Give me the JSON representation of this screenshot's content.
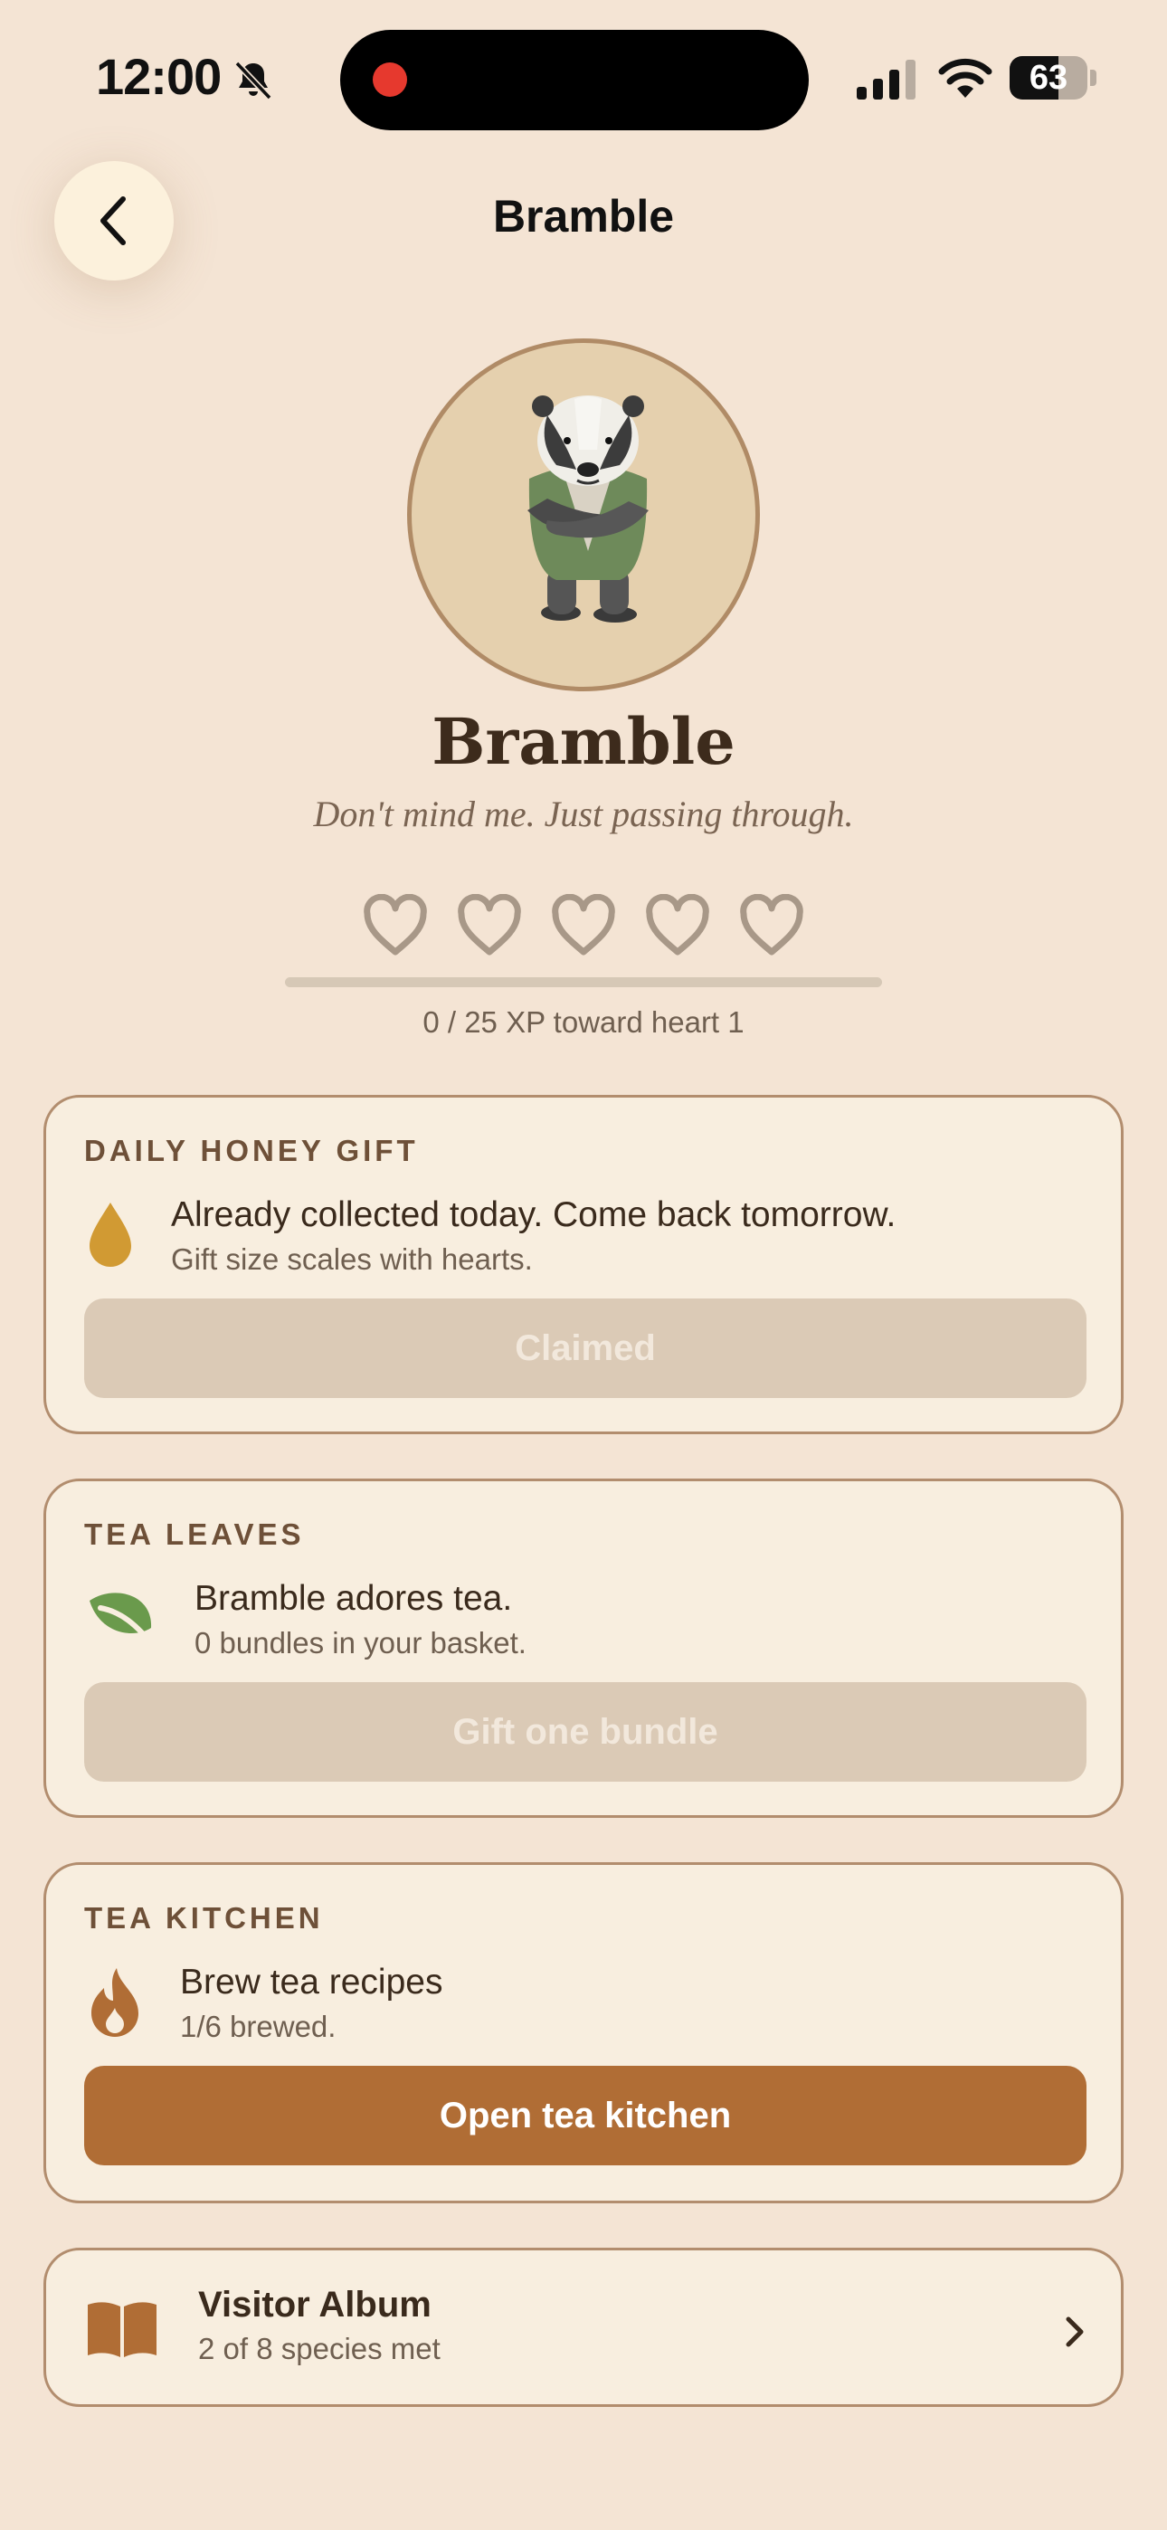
{
  "status": {
    "time": "12:00",
    "battery": "63",
    "battery_fraction": 0.63
  },
  "nav": {
    "title": "Bramble"
  },
  "character": {
    "name": "Bramble",
    "quote": "Don't mind me. Just passing through.",
    "hearts_filled": 0,
    "hearts_total": 5,
    "xp_text": "0 / 25 XP toward heart 1",
    "xp_progress": 0
  },
  "honey_card": {
    "title": "DAILY HONEY GIFT",
    "icon": "honey-drop-icon",
    "main": "Already collected today. Come back tomorrow.",
    "sub": "Gift size scales with hearts.",
    "button": "Claimed"
  },
  "tea_card": {
    "title": "TEA LEAVES",
    "icon": "leaf-icon",
    "main": "Bramble adores tea.",
    "sub": "0 bundles in your basket.",
    "button": "Gift one bundle"
  },
  "kitchen_card": {
    "title": "TEA KITCHEN",
    "icon": "flame-icon",
    "main": "Brew tea recipes",
    "sub": "1/6 brewed.",
    "button": "Open tea kitchen"
  },
  "album_card": {
    "icon": "book-icon",
    "title": "Visitor Album",
    "sub": "2 of 8 species met"
  },
  "colors": {
    "background": "#f4e4d4",
    "card": "#f8eedf",
    "card_border": "#b28d6e",
    "accent": "#b06d35",
    "honey": "#d19a33",
    "leaf": "#6a9a4c",
    "disabled": "#dbcab6"
  }
}
